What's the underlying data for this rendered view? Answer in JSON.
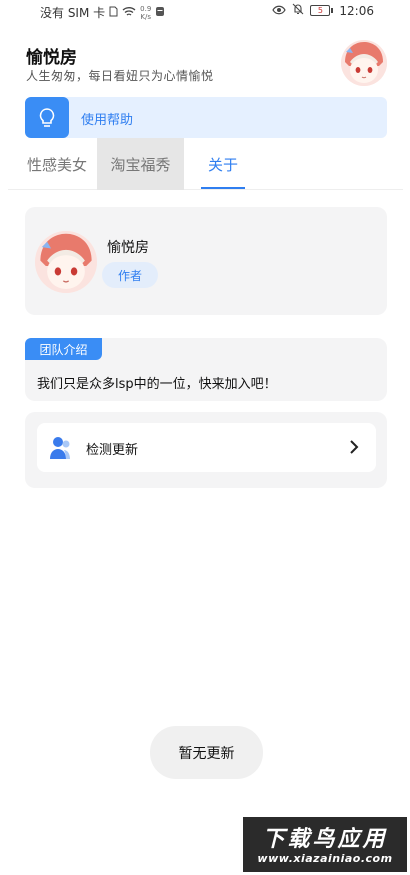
{
  "status_bar": {
    "carrier": "没有 SIM 卡",
    "net_speed_value": "0.9",
    "net_speed_unit": "K/s",
    "battery_level": "5",
    "time": "12:06"
  },
  "header": {
    "title": "愉悦房",
    "subtitle": "人生匆匆，每日看妞只为心情愉悦"
  },
  "help_banner": {
    "label": "使用帮助"
  },
  "tabs": [
    {
      "label": "性感美女"
    },
    {
      "label": "淘宝福秀"
    },
    {
      "label": "关于"
    }
  ],
  "about": {
    "author_name": "愉悦房",
    "author_role": "作者",
    "team_tag": "团队介绍",
    "team_description": "我们只是众多lsp中的一位，快来加入吧！",
    "update_label": "检测更新"
  },
  "toast": {
    "message": "暂无更新"
  },
  "watermark": {
    "top": "下载鸟应用",
    "bottom": "www.xiazainiao.com"
  },
  "colors": {
    "accent": "#3a8df5",
    "accent_text": "#2f7ef0",
    "banner_bg": "#e5f0ff",
    "card_bg": "#f4f4f5"
  },
  "icons": {
    "help": "lightbulb-icon",
    "update": "user-icon",
    "chevron": "chevron-right-icon"
  }
}
